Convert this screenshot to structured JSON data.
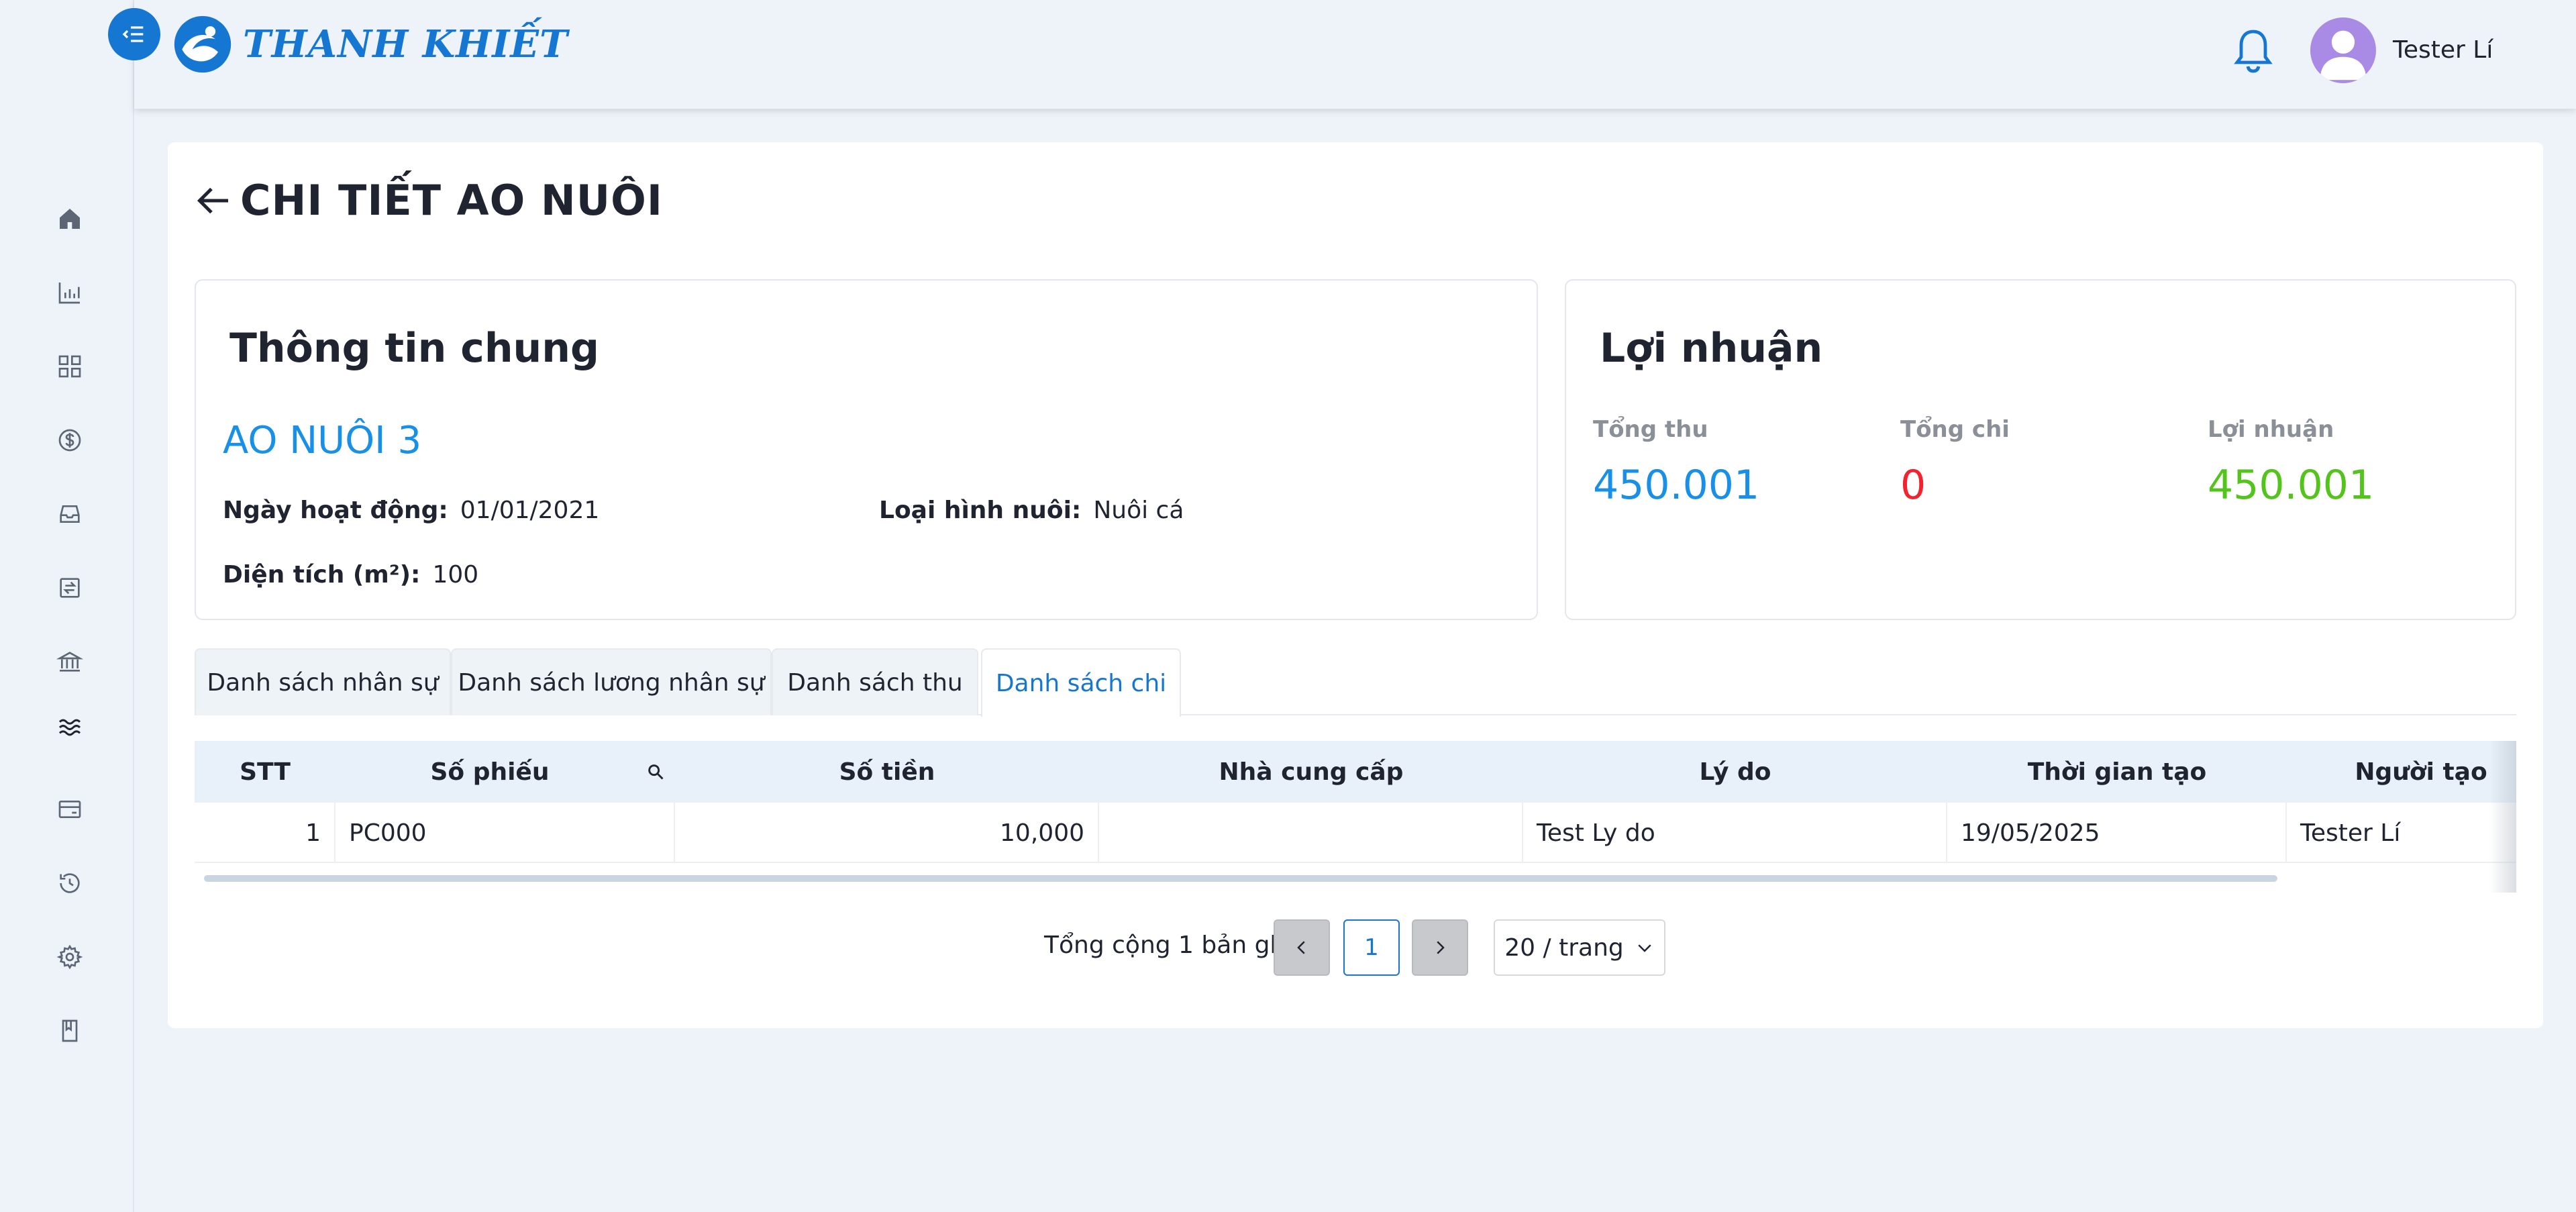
{
  "brand": {
    "name": "THANH KHIẾT"
  },
  "user": {
    "name": "Tester Lí"
  },
  "page": {
    "title": "CHI TIẾT AO NUÔI"
  },
  "info": {
    "title": "Thông tin chung",
    "pond_name": "AO NUÔI 3",
    "start_label": "Ngày hoạt động:",
    "start_value": "01/01/2021",
    "type_label": "Loại hình nuôi:",
    "type_value": "Nuôi cá",
    "area_label": "Diện tích (m²):",
    "area_value": "100"
  },
  "profit": {
    "title": "Lợi nhuận",
    "revenue_label": "Tổng thu",
    "revenue_value": "450.001",
    "expense_label": "Tổng chi",
    "expense_value": "0",
    "profit_label": "Lợi nhuận",
    "profit_value": "450.001"
  },
  "colors": {
    "accent": "#1677d2",
    "revenue": "#1890e8",
    "expense": "#f5222d",
    "profit": "#52c41a"
  },
  "tabs": [
    {
      "label": "Danh sách nhân sự"
    },
    {
      "label": "Danh sách lương nhân sự"
    },
    {
      "label": "Danh sách thu"
    },
    {
      "label": "Danh sách chi",
      "active": true
    }
  ],
  "table": {
    "headers": {
      "stt": "STT",
      "code": "Số phiếu",
      "amount": "Số tiền",
      "supplier": "Nhà cung cấp",
      "reason": "Lý do",
      "created": "Thời gian tạo",
      "creator": "Người tạo"
    },
    "rows": [
      {
        "stt": "1",
        "code": "PC000",
        "amount": "10,000",
        "supplier": "",
        "reason": "Test Ly do",
        "created": "19/05/2025",
        "creator": "Tester Lí"
      }
    ]
  },
  "pagination": {
    "total": "Tổng cộng 1 bản ghi",
    "current": "1",
    "page_size": "20 / trang"
  },
  "sidebar_icons": [
    "home-icon",
    "chart-icon",
    "grid-icon",
    "dollar-icon",
    "inbox-icon",
    "transfer-icon",
    "bank-icon",
    "waves-icon",
    "card-icon",
    "history-icon",
    "gear-icon",
    "book-icon"
  ]
}
